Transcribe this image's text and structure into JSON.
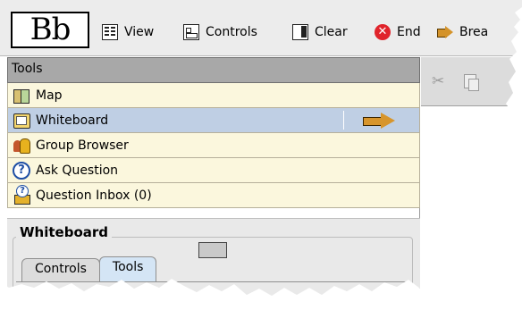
{
  "app": {
    "logo": "Bb"
  },
  "toolbar": {
    "view": "View",
    "controls": "Controls",
    "clear": "Clear",
    "end": "End",
    "break": "Brea"
  },
  "tools_panel": {
    "header": "Tools",
    "items": [
      {
        "label": "Map",
        "icon": "map-icon"
      },
      {
        "label": "Whiteboard",
        "icon": "whiteboard-icon",
        "selected": true
      },
      {
        "label": "Group Browser",
        "icon": "group-browser-icon"
      },
      {
        "label": "Ask Question",
        "icon": "question-icon"
      },
      {
        "label": "Question Inbox (0)",
        "icon": "question-inbox-icon"
      }
    ]
  },
  "whiteboard_panel": {
    "title": "Whiteboard",
    "tabs": [
      {
        "label": "Controls",
        "active": false
      },
      {
        "label": "Tools",
        "active": true
      }
    ]
  },
  "colors": {
    "toolbar_bg": "#ececec",
    "list_bg": "#fbf7dd",
    "selected_bg": "#bfcfe4",
    "header_bg": "#a8a8a8",
    "active_tab": "#d4e5f5"
  }
}
